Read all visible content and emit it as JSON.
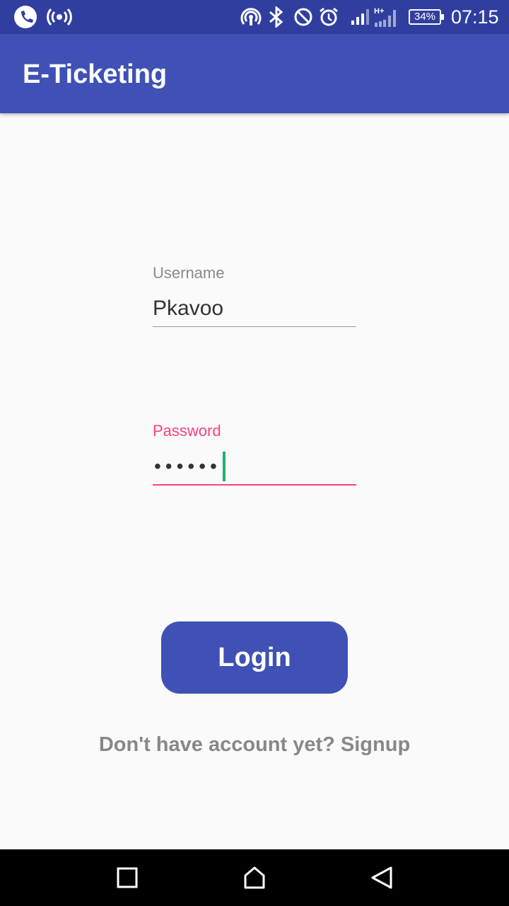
{
  "status_bar": {
    "battery": "34%",
    "time": "07:15",
    "icons": [
      "phone-call-icon",
      "broadcast-icon",
      "hotspot-icon",
      "bluetooth-icon",
      "do-not-disturb-icon",
      "alarm-icon",
      "signal-icon",
      "signal-hplus-icon"
    ]
  },
  "app_bar": {
    "title": "E-Ticketing"
  },
  "form": {
    "username": {
      "label": "Username",
      "value": "Pkavoo"
    },
    "password": {
      "label": "Password",
      "masked_value": "••••••"
    }
  },
  "login_button": {
    "label": "Login"
  },
  "signup_link": {
    "text": "Don't have account yet? Signup"
  },
  "nav_bar": {
    "icons": [
      "recents-icon",
      "home-icon",
      "back-icon"
    ]
  },
  "colors": {
    "status_bar": "#303f9f",
    "primary": "#3f51b5",
    "accent": "#ff4081",
    "cursor": "#1bb36e",
    "background": "#fafafa"
  }
}
